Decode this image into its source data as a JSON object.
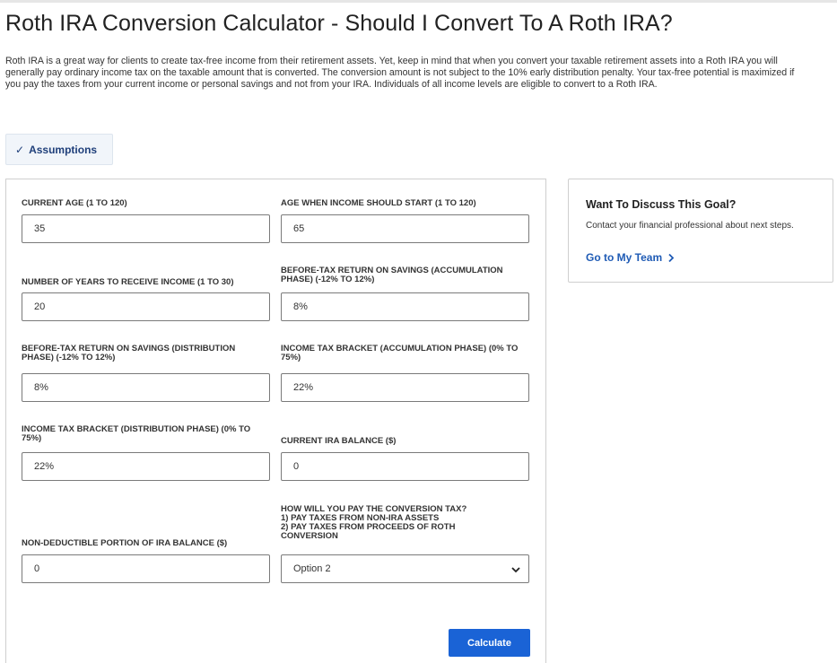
{
  "page": {
    "title": "Roth IRA Conversion Calculator - Should I Convert To A Roth IRA?",
    "intro": "Roth IRA is a great way for clients to create tax-free income from their retirement assets. Yet, keep in mind that when you convert your taxable retirement assets into a Roth IRA you will generally pay ordinary income tax on the taxable amount that is converted. The conversion amount is not subject to the 10% early distribution penalty. Your tax-free potential is maximized if you pay the taxes from your current income or personal savings and not from your IRA. Individuals of all income levels are eligible to convert to a Roth IRA."
  },
  "assumptions": {
    "label": "Assumptions",
    "icon": "check-icon"
  },
  "form": {
    "current_age": {
      "label": "CURRENT AGE (1 TO 120)",
      "value": "35"
    },
    "start_age": {
      "label": "AGE WHEN INCOME SHOULD START (1 TO 120)",
      "value": "65"
    },
    "years_income": {
      "label": "NUMBER OF YEARS TO RECEIVE INCOME (1 TO 30)",
      "value": "20"
    },
    "return_accum": {
      "label": "BEFORE-TAX RETURN ON SAVINGS (ACCUMULATION PHASE) (-12% TO 12%)",
      "value": "8%"
    },
    "return_dist": {
      "label": "BEFORE-TAX RETURN ON SAVINGS (DISTRIBUTION PHASE) (-12% TO 12%)",
      "value": "8%"
    },
    "tax_accum": {
      "label": "INCOME TAX BRACKET (ACCUMULATION PHASE) (0% TO 75%)",
      "value": "22%"
    },
    "tax_dist": {
      "label": "INCOME TAX BRACKET (DISTRIBUTION PHASE) (0% TO 75%)",
      "value": "22%"
    },
    "ira_balance": {
      "label": "CURRENT IRA BALANCE ($)",
      "value": "0"
    },
    "nondeductible": {
      "label": "NON-DEDUCTIBLE PORTION OF IRA BALANCE ($)",
      "value": "0"
    },
    "pay_tax": {
      "label_line1": "HOW WILL YOU PAY THE CONVERSION TAX?",
      "label_line2": "1) PAY TAXES FROM NON-IRA ASSETS",
      "label_line3": "2) PAY TAXES FROM PROCEEDS OF ROTH CONVERSION",
      "value": "Option 2"
    },
    "calculate_label": "Calculate"
  },
  "side": {
    "heading": "Want To Discuss This Goal?",
    "text": "Contact your financial professional about next steps.",
    "link": "Go to My Team",
    "link_icon": "chevron-right-icon"
  }
}
